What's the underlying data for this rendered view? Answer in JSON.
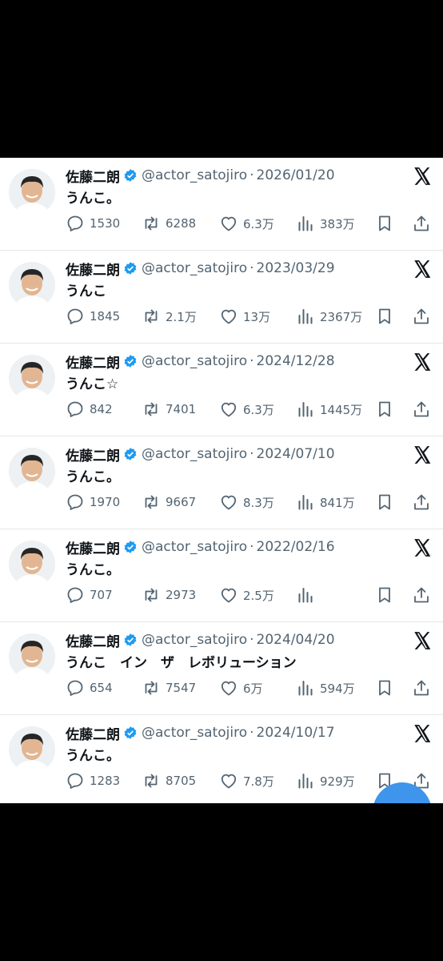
{
  "colors": {
    "background": "#000000",
    "card": "#ffffff",
    "text_primary": "#0f1419",
    "text_secondary": "#536471",
    "verified_badge": "#1d9bf0",
    "fab": "#3f95ec"
  },
  "icons": {
    "reply": "speech-bubble-icon",
    "retweet": "retweet-icon",
    "like": "heart-icon",
    "views": "bar-chart-icon",
    "bookmark": "bookmark-icon",
    "share": "share-icon",
    "platform": "x-logo-icon",
    "verified": "verified-badge-icon"
  },
  "tweets": [
    {
      "name": "佐藤二朗",
      "handle": "@actor_satojiro",
      "separator": "·",
      "date": "2026/01/20",
      "text": "うんこ。",
      "replies": "1530",
      "retweets": "6288",
      "likes": "6.3万",
      "views": "383万"
    },
    {
      "name": "佐藤二朗",
      "handle": "@actor_satojiro",
      "separator": "·",
      "date": "2023/03/29",
      "text": "うんこ",
      "replies": "1845",
      "retweets": "2.1万",
      "likes": "13万",
      "views": "2367万"
    },
    {
      "name": "佐藤二朗",
      "handle": "@actor_satojiro",
      "separator": "·",
      "date": "2024/12/28",
      "text": "うんこ☆",
      "replies": "842",
      "retweets": "7401",
      "likes": "6.3万",
      "views": "1445万"
    },
    {
      "name": "佐藤二朗",
      "handle": "@actor_satojiro",
      "separator": "·",
      "date": "2024/07/10",
      "text": "うんこ。",
      "replies": "1970",
      "retweets": "9667",
      "likes": "8.3万",
      "views": "841万"
    },
    {
      "name": "佐藤二朗",
      "handle": "@actor_satojiro",
      "separator": "·",
      "date": "2022/02/16",
      "text": "うんこ。",
      "replies": "707",
      "retweets": "2973",
      "likes": "2.5万",
      "views": ""
    },
    {
      "name": "佐藤二朗",
      "handle": "@actor_satojiro",
      "separator": "·",
      "date": "2024/04/20",
      "text": "うんこ　イン　ザ　レボリューション",
      "replies": "654",
      "retweets": "7547",
      "likes": "6万",
      "views": "594万"
    },
    {
      "name": "佐藤二朗",
      "handle": "@actor_satojiro",
      "separator": "·",
      "date": "2024/10/17",
      "text": "うんこ。",
      "replies": "1283",
      "retweets": "8705",
      "likes": "7.8万",
      "views": "929万"
    }
  ]
}
